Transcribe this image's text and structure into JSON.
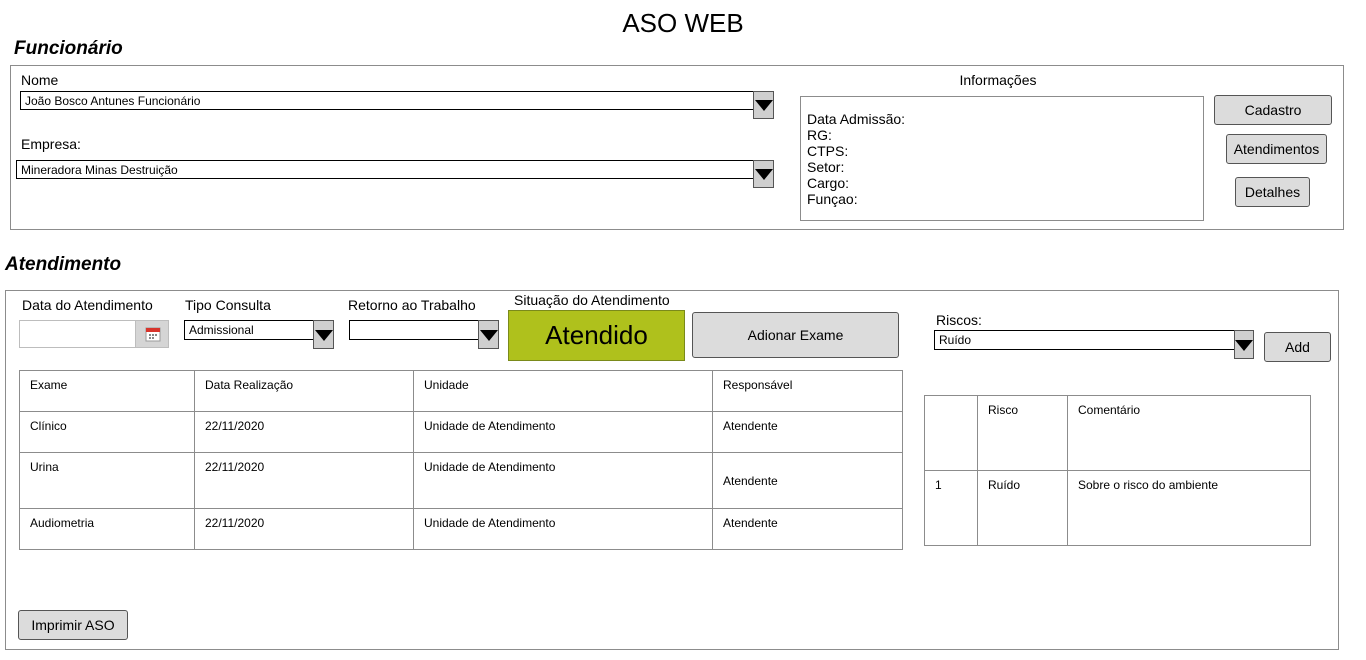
{
  "app": {
    "title": "ASO WEB"
  },
  "funcionario": {
    "section_title": "Funcionário",
    "nome_label": "Nome",
    "nome_value": "João Bosco Antunes Funcionário",
    "empresa_label": "Empresa:",
    "empresa_value": "Mineradora Minas Destruição",
    "informacoes_label": "Informações",
    "info_fields": [
      "Data Admissão:",
      "RG:",
      "CTPS:",
      "Setor:",
      "Cargo:",
      "Funçao:"
    ],
    "buttons": {
      "cadastro": "Cadastro",
      "atendimentos": "Atendimentos",
      "detalhes": "Detalhes"
    }
  },
  "atendimento": {
    "section_title": "Atendimento",
    "data_label": "Data do Atendimento",
    "data_value": "",
    "tipo_label": "Tipo Consulta",
    "tipo_value": "Admissional",
    "retorno_label": "Retorno ao Trabalho",
    "retorno_value": "",
    "situacao_label": "Situação do Atendimento",
    "situacao_value": "Atendido",
    "situacao_color": "#afc11c",
    "adicionar_exame_label": "Adionar Exame",
    "riscos_label": "Riscos:",
    "riscos_value": "Ruído",
    "add_label": "Add",
    "imprimir_label": "Imprimir ASO",
    "exames_table": {
      "headers": [
        "Exame",
        "Data Realização",
        "Unidade",
        "Responsável"
      ],
      "rows": [
        [
          "Clínico",
          "22/11/2020",
          "Unidade de Atendimento",
          "Atendente"
        ],
        [
          "Urina",
          "22/11/2020",
          "Unidade de Atendimento",
          "Atendente"
        ],
        [
          "Audiometria",
          "22/11/2020",
          "Unidade de Atendimento",
          "Atendente"
        ]
      ]
    },
    "riscos_table": {
      "headers": [
        "",
        "Risco",
        "Comentário"
      ],
      "rows": [
        [
          "1",
          "Ruído",
          "Sobre o risco do ambiente"
        ]
      ]
    }
  }
}
